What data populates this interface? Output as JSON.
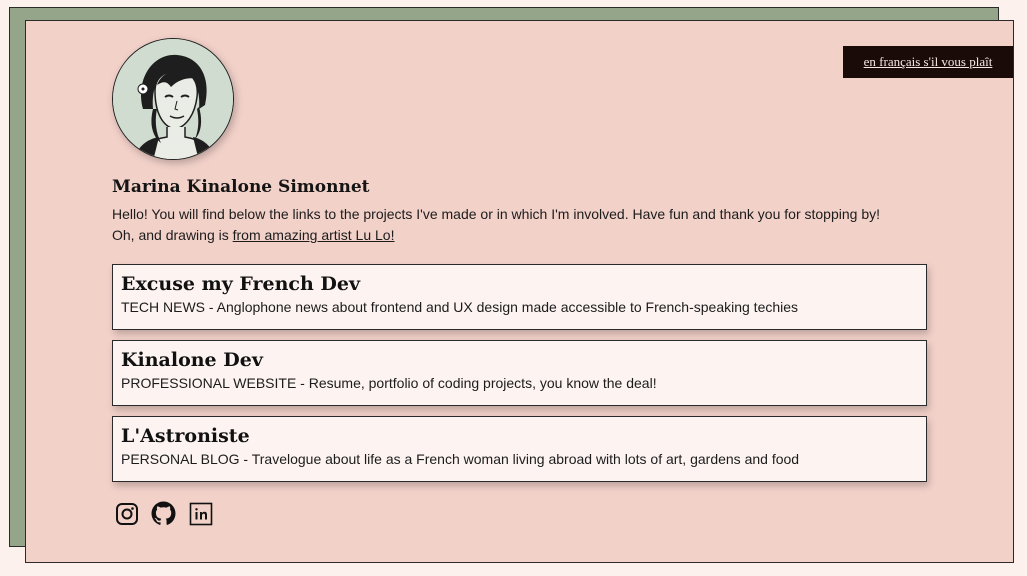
{
  "language_toggle": "en français s'il vous plaît",
  "profile": {
    "name": "Marina Kinalone Simonnet",
    "intro_line1": "Hello! You will find below the links to the projects I've made or in which I'm involved. Have fun and thank you for stopping by!",
    "intro_line2_prefix": "Oh, and drawing is ",
    "intro_link": "from amazing artist Lu Lo!"
  },
  "projects": [
    {
      "title": "Excuse my French Dev",
      "description": "TECH NEWS - Anglophone news about frontend and UX design made accessible to French-speaking techies"
    },
    {
      "title": "Kinalone Dev",
      "description": "PROFESSIONAL WEBSITE - Resume, portfolio of coding projects, you know the deal!"
    },
    {
      "title": "L'Astroniste",
      "description": "PERSONAL BLOG - Travelogue about life as a French woman living abroad with lots of art, gardens and food"
    }
  ],
  "socials": [
    "instagram-icon",
    "github-icon",
    "linkedin-icon"
  ],
  "colors": {
    "background": "#fdf1ee",
    "panel": "#f2d1c9",
    "offset_panel": "#95a58a",
    "card": "#fdf4f2",
    "button": "#1a0a08"
  }
}
